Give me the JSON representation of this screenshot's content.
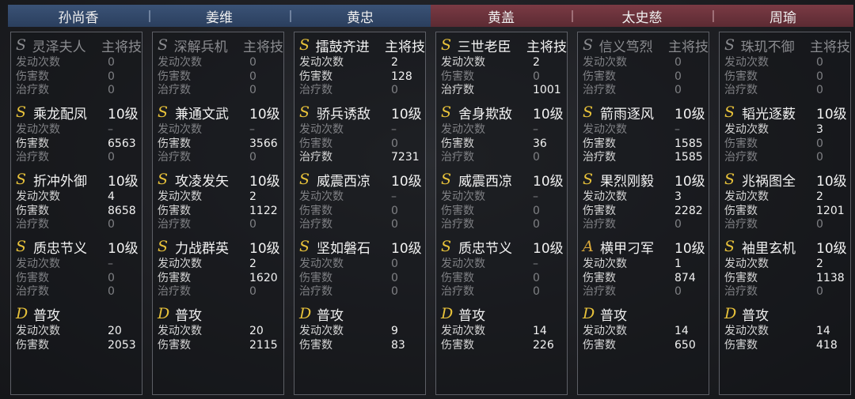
{
  "headers": [
    {
      "name": "孙尚香",
      "side": "blue"
    },
    {
      "name": "姜维",
      "side": "blue"
    },
    {
      "name": "黄忠",
      "side": "blue"
    },
    {
      "name": "黄盖",
      "side": "red"
    },
    {
      "name": "太史慈",
      "side": "red"
    },
    {
      "name": "周瑜",
      "side": "red"
    }
  ],
  "labels": {
    "trigger": "发动次数",
    "damage": "伤害数",
    "heal": "治疗数"
  },
  "colors": {
    "blue_header": "#2b3f5e",
    "red_header": "#5c2b33",
    "grade_gold": "#e8c23a"
  },
  "columns": [
    {
      "skills": [
        {
          "grade": "S",
          "name": "灵泽夫人",
          "tag": "主将技",
          "dim": true,
          "trigger": "0",
          "damage": "0",
          "heal": "0",
          "d_trigger": true,
          "d_damage": true,
          "d_heal": true
        },
        {
          "grade": "S",
          "name": "乘龙配凤",
          "tag": "10级",
          "trigger": "–",
          "damage": "6563",
          "heal": "0",
          "d_trigger": true,
          "d_damage": false,
          "d_heal": true
        },
        {
          "grade": "S",
          "name": "折冲外御",
          "tag": "10级",
          "trigger": "4",
          "damage": "8658",
          "heal": "0",
          "d_trigger": false,
          "d_damage": false,
          "d_heal": true
        },
        {
          "grade": "S",
          "name": "质忠节义",
          "tag": "10级",
          "trigger": "–",
          "damage": "0",
          "heal": "0",
          "d_trigger": true,
          "d_damage": true,
          "d_heal": true
        },
        {
          "grade": "D",
          "name": "普攻",
          "tag": "",
          "trigger": "20",
          "damage": "2053"
        }
      ]
    },
    {
      "skills": [
        {
          "grade": "S",
          "name": "深解兵机",
          "tag": "主将技",
          "dim": true,
          "trigger": "0",
          "damage": "0",
          "heal": "0",
          "d_trigger": true,
          "d_damage": true,
          "d_heal": true
        },
        {
          "grade": "S",
          "name": "兼通文武",
          "tag": "10级",
          "trigger": "–",
          "damage": "3566",
          "heal": "0",
          "d_trigger": true,
          "d_damage": false,
          "d_heal": true
        },
        {
          "grade": "S",
          "name": "攻凌发矢",
          "tag": "10级",
          "trigger": "2",
          "damage": "1122",
          "heal": "0",
          "d_trigger": false,
          "d_damage": false,
          "d_heal": true
        },
        {
          "grade": "S",
          "name": "力战群英",
          "tag": "10级",
          "trigger": "2",
          "damage": "1620",
          "heal": "0",
          "d_trigger": false,
          "d_damage": false,
          "d_heal": true
        },
        {
          "grade": "D",
          "name": "普攻",
          "tag": "",
          "trigger": "20",
          "damage": "2115"
        }
      ]
    },
    {
      "skills": [
        {
          "grade": "S",
          "name": "擂鼓齐进",
          "tag": "主将技",
          "dim": false,
          "trigger": "2",
          "damage": "128",
          "heal": "0",
          "d_trigger": false,
          "d_damage": false,
          "d_heal": true
        },
        {
          "grade": "S",
          "name": "骄兵诱敌",
          "tag": "10级",
          "trigger": "–",
          "damage": "0",
          "heal": "7231",
          "d_trigger": true,
          "d_damage": true,
          "d_heal": false
        },
        {
          "grade": "S",
          "name": "威震西凉",
          "tag": "10级",
          "trigger": "–",
          "damage": "0",
          "heal": "0",
          "d_trigger": true,
          "d_damage": true,
          "d_heal": true
        },
        {
          "grade": "S",
          "name": "坚如磐石",
          "tag": "10级",
          "trigger": "0",
          "damage": "0",
          "heal": "0",
          "d_trigger": true,
          "d_damage": true,
          "d_heal": true
        },
        {
          "grade": "D",
          "name": "普攻",
          "tag": "",
          "trigger": "9",
          "damage": "83"
        }
      ]
    },
    {
      "skills": [
        {
          "grade": "S",
          "name": "三世老臣",
          "tag": "主将技",
          "dim": false,
          "trigger": "2",
          "damage": "0",
          "heal": "1001",
          "d_trigger": false,
          "d_damage": true,
          "d_heal": false
        },
        {
          "grade": "S",
          "name": "舍身欺敌",
          "tag": "10级",
          "trigger": "–",
          "damage": "36",
          "heal": "0",
          "d_trigger": true,
          "d_damage": false,
          "d_heal": true
        },
        {
          "grade": "S",
          "name": "威震西凉",
          "tag": "10级",
          "trigger": "–",
          "damage": "0",
          "heal": "0",
          "d_trigger": true,
          "d_damage": true,
          "d_heal": true
        },
        {
          "grade": "S",
          "name": "质忠节义",
          "tag": "10级",
          "trigger": "–",
          "damage": "0",
          "heal": "0",
          "d_trigger": true,
          "d_damage": true,
          "d_heal": true
        },
        {
          "grade": "D",
          "name": "普攻",
          "tag": "",
          "trigger": "14",
          "damage": "226"
        }
      ]
    },
    {
      "skills": [
        {
          "grade": "S",
          "name": "信义笃烈",
          "tag": "主将技",
          "dim": true,
          "trigger": "0",
          "damage": "0",
          "heal": "0",
          "d_trigger": true,
          "d_damage": true,
          "d_heal": true
        },
        {
          "grade": "S",
          "name": "箭雨逐风",
          "tag": "10级",
          "trigger": "–",
          "damage": "1585",
          "heal": "1585",
          "d_trigger": true,
          "d_damage": false,
          "d_heal": false
        },
        {
          "grade": "S",
          "name": "果烈刚毅",
          "tag": "10级",
          "trigger": "3",
          "damage": "2282",
          "heal": "0",
          "d_trigger": false,
          "d_damage": false,
          "d_heal": true
        },
        {
          "grade": "A",
          "name": "横甲刁军",
          "tag": "10级",
          "trigger": "1",
          "damage": "874",
          "heal": "0",
          "d_trigger": false,
          "d_damage": false,
          "d_heal": true
        },
        {
          "grade": "D",
          "name": "普攻",
          "tag": "",
          "trigger": "14",
          "damage": "650"
        }
      ]
    },
    {
      "skills": [
        {
          "grade": "S",
          "name": "珠玑不御",
          "tag": "主将技",
          "dim": true,
          "trigger": "0",
          "damage": "0",
          "heal": "0",
          "d_trigger": true,
          "d_damage": true,
          "d_heal": true
        },
        {
          "grade": "S",
          "name": "韬光逐薮",
          "tag": "10级",
          "trigger": "3",
          "damage": "0",
          "heal": "0",
          "d_trigger": false,
          "d_damage": true,
          "d_heal": true
        },
        {
          "grade": "S",
          "name": "兆祸图全",
          "tag": "10级",
          "trigger": "2",
          "damage": "1201",
          "heal": "0",
          "d_trigger": false,
          "d_damage": false,
          "d_heal": true
        },
        {
          "grade": "S",
          "name": "袖里玄机",
          "tag": "10级",
          "trigger": "2",
          "damage": "1138",
          "heal": "0",
          "d_trigger": false,
          "d_damage": false,
          "d_heal": true
        },
        {
          "grade": "D",
          "name": "普攻",
          "tag": "",
          "trigger": "14",
          "damage": "418"
        }
      ]
    }
  ]
}
